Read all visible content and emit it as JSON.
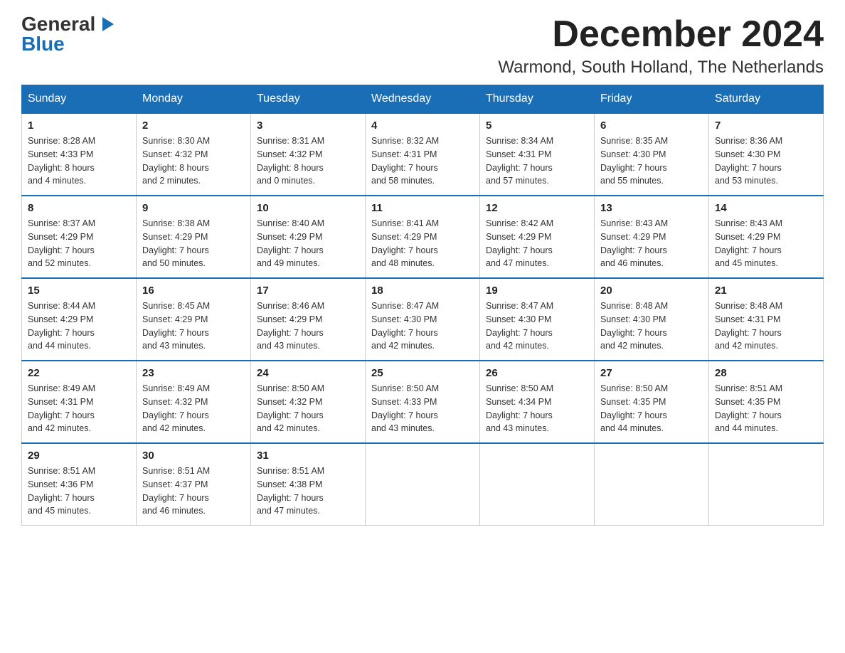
{
  "logo": {
    "general": "General",
    "blue": "Blue"
  },
  "header": {
    "month": "December 2024",
    "location": "Warmond, South Holland, The Netherlands"
  },
  "days_of_week": [
    "Sunday",
    "Monday",
    "Tuesday",
    "Wednesday",
    "Thursday",
    "Friday",
    "Saturday"
  ],
  "weeks": [
    [
      {
        "day": "1",
        "sunrise": "8:28 AM",
        "sunset": "4:33 PM",
        "daylight": "8 hours and 4 minutes."
      },
      {
        "day": "2",
        "sunrise": "8:30 AM",
        "sunset": "4:32 PM",
        "daylight": "8 hours and 2 minutes."
      },
      {
        "day": "3",
        "sunrise": "8:31 AM",
        "sunset": "4:32 PM",
        "daylight": "8 hours and 0 minutes."
      },
      {
        "day": "4",
        "sunrise": "8:32 AM",
        "sunset": "4:31 PM",
        "daylight": "7 hours and 58 minutes."
      },
      {
        "day": "5",
        "sunrise": "8:34 AM",
        "sunset": "4:31 PM",
        "daylight": "7 hours and 57 minutes."
      },
      {
        "day": "6",
        "sunrise": "8:35 AM",
        "sunset": "4:30 PM",
        "daylight": "7 hours and 55 minutes."
      },
      {
        "day": "7",
        "sunrise": "8:36 AM",
        "sunset": "4:30 PM",
        "daylight": "7 hours and 53 minutes."
      }
    ],
    [
      {
        "day": "8",
        "sunrise": "8:37 AM",
        "sunset": "4:29 PM",
        "daylight": "7 hours and 52 minutes."
      },
      {
        "day": "9",
        "sunrise": "8:38 AM",
        "sunset": "4:29 PM",
        "daylight": "7 hours and 50 minutes."
      },
      {
        "day": "10",
        "sunrise": "8:40 AM",
        "sunset": "4:29 PM",
        "daylight": "7 hours and 49 minutes."
      },
      {
        "day": "11",
        "sunrise": "8:41 AM",
        "sunset": "4:29 PM",
        "daylight": "7 hours and 48 minutes."
      },
      {
        "day": "12",
        "sunrise": "8:42 AM",
        "sunset": "4:29 PM",
        "daylight": "7 hours and 47 minutes."
      },
      {
        "day": "13",
        "sunrise": "8:43 AM",
        "sunset": "4:29 PM",
        "daylight": "7 hours and 46 minutes."
      },
      {
        "day": "14",
        "sunrise": "8:43 AM",
        "sunset": "4:29 PM",
        "daylight": "7 hours and 45 minutes."
      }
    ],
    [
      {
        "day": "15",
        "sunrise": "8:44 AM",
        "sunset": "4:29 PM",
        "daylight": "7 hours and 44 minutes."
      },
      {
        "day": "16",
        "sunrise": "8:45 AM",
        "sunset": "4:29 PM",
        "daylight": "7 hours and 43 minutes."
      },
      {
        "day": "17",
        "sunrise": "8:46 AM",
        "sunset": "4:29 PM",
        "daylight": "7 hours and 43 minutes."
      },
      {
        "day": "18",
        "sunrise": "8:47 AM",
        "sunset": "4:30 PM",
        "daylight": "7 hours and 42 minutes."
      },
      {
        "day": "19",
        "sunrise": "8:47 AM",
        "sunset": "4:30 PM",
        "daylight": "7 hours and 42 minutes."
      },
      {
        "day": "20",
        "sunrise": "8:48 AM",
        "sunset": "4:30 PM",
        "daylight": "7 hours and 42 minutes."
      },
      {
        "day": "21",
        "sunrise": "8:48 AM",
        "sunset": "4:31 PM",
        "daylight": "7 hours and 42 minutes."
      }
    ],
    [
      {
        "day": "22",
        "sunrise": "8:49 AM",
        "sunset": "4:31 PM",
        "daylight": "7 hours and 42 minutes."
      },
      {
        "day": "23",
        "sunrise": "8:49 AM",
        "sunset": "4:32 PM",
        "daylight": "7 hours and 42 minutes."
      },
      {
        "day": "24",
        "sunrise": "8:50 AM",
        "sunset": "4:32 PM",
        "daylight": "7 hours and 42 minutes."
      },
      {
        "day": "25",
        "sunrise": "8:50 AM",
        "sunset": "4:33 PM",
        "daylight": "7 hours and 43 minutes."
      },
      {
        "day": "26",
        "sunrise": "8:50 AM",
        "sunset": "4:34 PM",
        "daylight": "7 hours and 43 minutes."
      },
      {
        "day": "27",
        "sunrise": "8:50 AM",
        "sunset": "4:35 PM",
        "daylight": "7 hours and 44 minutes."
      },
      {
        "day": "28",
        "sunrise": "8:51 AM",
        "sunset": "4:35 PM",
        "daylight": "7 hours and 44 minutes."
      }
    ],
    [
      {
        "day": "29",
        "sunrise": "8:51 AM",
        "sunset": "4:36 PM",
        "daylight": "7 hours and 45 minutes."
      },
      {
        "day": "30",
        "sunrise": "8:51 AM",
        "sunset": "4:37 PM",
        "daylight": "7 hours and 46 minutes."
      },
      {
        "day": "31",
        "sunrise": "8:51 AM",
        "sunset": "4:38 PM",
        "daylight": "7 hours and 47 minutes."
      },
      null,
      null,
      null,
      null
    ]
  ],
  "labels": {
    "sunrise": "Sunrise:",
    "sunset": "Sunset:",
    "daylight": "Daylight:"
  }
}
